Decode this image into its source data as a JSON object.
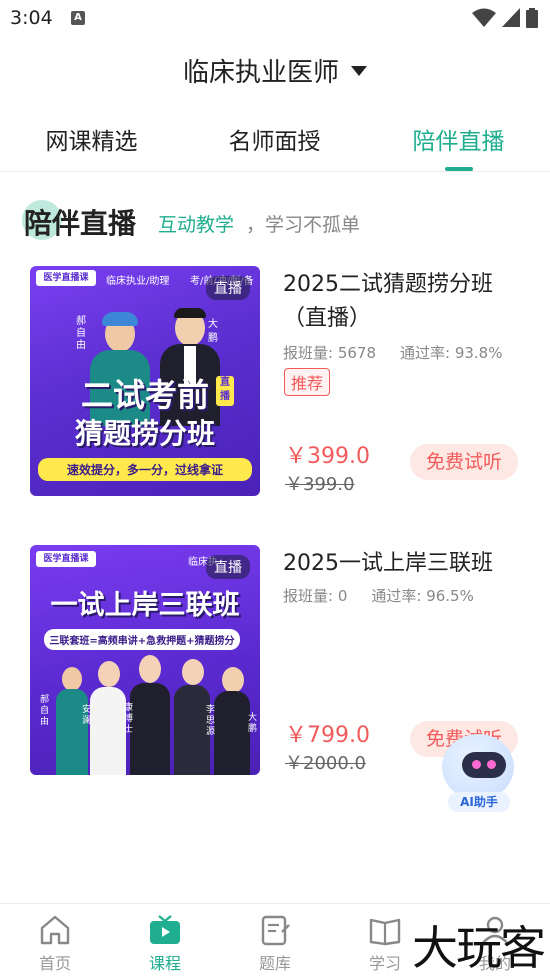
{
  "status": {
    "time": "3:04",
    "a_icon": "A"
  },
  "header": {
    "title": "临床执业医师"
  },
  "tabs": [
    {
      "label": "网课精选",
      "active": false
    },
    {
      "label": "名师面授",
      "active": false
    },
    {
      "label": "陪伴直播",
      "active": true
    }
  ],
  "section": {
    "title": "陪伴直播",
    "subtitle_highlight": "互动教学",
    "subtitle_rest": "，学习不孤单"
  },
  "courses": [
    {
      "title": "2025二试猜题捞分班（直播）",
      "enroll_label": "报班量: 5678",
      "pass_label": "通过率: 93.8%",
      "tag": "推荐",
      "price": "￥399.0",
      "original_price": "￥399.0",
      "trial_button": "免费试听",
      "thumb": {
        "live_badge": "直播",
        "brand": "医学直播课",
        "header_text": "临床执业/助理",
        "corner_text": "考/前/冲/刺/备",
        "headline1": "二试考前",
        "headline2": "猜题捞分班",
        "banner": "速效提分，多一分，过线拿证",
        "teacher1": "郝自由",
        "teacher2": "大鹏",
        "badge": "直播"
      }
    },
    {
      "title": "2025一试上岸三联班",
      "enroll_label": "报班量: 0",
      "pass_label": "通过率: 96.5%",
      "tag": "",
      "price": "￥799.0",
      "original_price": "￥2000.0",
      "trial_button": "免费试听",
      "thumb": {
        "live_badge": "直播",
        "brand": "医学直播课",
        "header_text": "临床执",
        "headline1": "一试上岸三联班",
        "banner": "三联套班=高频串讲+急救押题+猜题捞分",
        "teachers": [
          "郝自由",
          "安澜",
          "康博士",
          "李思源",
          "大鹏"
        ]
      }
    }
  ],
  "ai_assistant": {
    "label": "AI助手"
  },
  "bottom_nav": [
    {
      "label": "首页",
      "icon": "home-icon",
      "active": false
    },
    {
      "label": "课程",
      "icon": "tv-icon",
      "active": true
    },
    {
      "label": "题库",
      "icon": "clipboard-icon",
      "active": false
    },
    {
      "label": "学习",
      "icon": "book-icon",
      "active": false
    },
    {
      "label": "我的",
      "icon": "user-icon",
      "active": false
    }
  ],
  "watermark": "大玩客",
  "colors": {
    "accent": "#1fae8f",
    "price": "#f25b5b",
    "purple": "#5b2fd0"
  }
}
